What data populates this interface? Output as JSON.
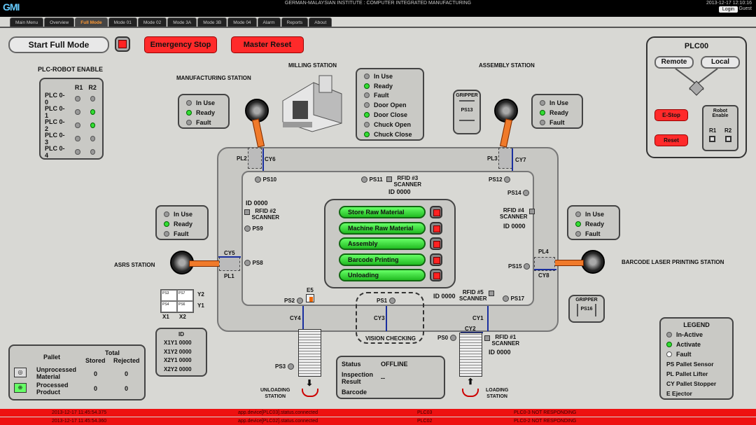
{
  "header": {
    "logo": "GMI",
    "institute": "GERMAN-MALAYSIAN INSTITUTE : COMPUTER INTEGRATED MANUFACTURING",
    "datetime": "2013-12-17 12:10:16",
    "login": "Login",
    "user": "Guest"
  },
  "tabs": [
    "Main Menu",
    "Overview",
    "Full Mode",
    "Mode 01",
    "Mode 02",
    "Mode 3A",
    "Mode 3B",
    "Mode 04",
    "Alarm",
    "Reports",
    "About"
  ],
  "controls": {
    "start": "Start Full Mode",
    "estop": "Emergency Stop",
    "reset": "Master Reset"
  },
  "robot_enable": {
    "title": "PLC-ROBOT ENABLE",
    "cols": [
      "R1",
      "R2"
    ],
    "rows": [
      {
        "name": "PLC 0-0",
        "r1": false,
        "r2": false
      },
      {
        "name": "PLC 0-1",
        "r1": false,
        "r2": true
      },
      {
        "name": "PLC 0-2",
        "r1": false,
        "r2": true
      },
      {
        "name": "PLC 0-3",
        "r1": false,
        "r2": false
      },
      {
        "name": "PLC 0-4",
        "r1": false,
        "r2": false
      }
    ]
  },
  "stations": {
    "manufacturing": "MANUFACTURING STATION",
    "milling": "MILLING STATION",
    "assembly": "ASSEMBLY STATION",
    "asrs": "ASRS STATION",
    "barcode": "BARCODE LASER PRINTING STATION",
    "unloading": "UNLOADING\nSTATION",
    "loading": "LOADING\nSTATION",
    "vision": "VISION CHECKING"
  },
  "status3": {
    "in_use": "In Use",
    "ready": "Ready",
    "fault": "Fault"
  },
  "milling_status": [
    "In Use",
    "Ready",
    "Fault",
    "Door Open",
    "Door Close",
    "Chuck Open",
    "Chuck Close"
  ],
  "milling_on": [
    false,
    true,
    false,
    false,
    true,
    false,
    true
  ],
  "gripper": {
    "title": "GRIPPER",
    "ps13": "PS13",
    "ps16": "PS16"
  },
  "track": {
    "pl2": "PL2",
    "cy6": "CY6",
    "pl3": "PL3",
    "cy7": "CY7",
    "ps10": "PS10",
    "ps11": "PS11",
    "rfid3": "RFID #3\nSCANNER",
    "id3": "ID  0000",
    "ps12": "PS12",
    "ps14": "PS14",
    "id2": "ID  0000",
    "rfid2": "RFID #2\nSCANNER",
    "ps9": "PS9",
    "rfid4": "RFID #4\nSCANNER",
    "id4": "ID  0000",
    "cy5": "CY5",
    "pl1": "PL1",
    "ps8": "PS8",
    "pl4": "PL4",
    "cy8": "CY8",
    "ps15": "PS15",
    "ps2": "PS2",
    "e5": "E5",
    "ps1": "PS1",
    "id5": "ID  0000",
    "rfid5": "RFID #5\nSCANNER",
    "ps17": "PS17",
    "cy4": "CY4",
    "cy3": "CY3",
    "cy1": "CY1",
    "cy2": "CY2",
    "ps0": "PS0",
    "rfid1": "RFID #1\nSCANNER",
    "id1": "ID  0000",
    "ps3": "PS3"
  },
  "modes": [
    "Store Raw Material",
    "Machine Raw Material",
    "Assembly",
    "Barcode Printing",
    "Unloading"
  ],
  "grid": {
    "cells": [
      "PS3",
      "PS7",
      "PS4",
      "PS6"
    ],
    "y2": "Y2",
    "y1": "Y1",
    "x1": "X1",
    "x2": "X2"
  },
  "id_panel": {
    "title": "ID",
    "rows": [
      "X1Y1 0000",
      "X1Y2 0000",
      "X2Y1 0000",
      "X2Y2 0000"
    ]
  },
  "pallet": {
    "title": "Pallet",
    "total": "Total",
    "stored": "Stored",
    "rejected": "Rejected",
    "rows": [
      {
        "name": "Unprocessed\nMaterial",
        "stored": "0",
        "rejected": "0"
      },
      {
        "name": "Processed\nProduct",
        "stored": "0",
        "rejected": "0"
      }
    ]
  },
  "vision_panel": {
    "status_lbl": "Status",
    "status_val": "OFFLINE",
    "insp_lbl": "Inspection\nResult",
    "insp_val": "--",
    "barcode_lbl": "Barcode"
  },
  "plc00": {
    "title": "PLC00",
    "remote": "Remote",
    "local": "Local",
    "estop": "E-Stop",
    "reset": "Reset",
    "robot": "Robot\nEnable",
    "r1": "R1",
    "r2": "R2"
  },
  "legend": {
    "title": "LEGEND",
    "items": [
      "In-Active",
      "Activate",
      "Fault"
    ],
    "defs": [
      "PS Pallet Sensor",
      "PL Pallet Lifter",
      "CY Pallet Stopper",
      "E Ejector"
    ]
  },
  "footer": [
    {
      "time": "2013-12-17 11:45:54.375",
      "msg": "app.device[PLC03].status.connected",
      "src": "PLC03",
      "text": "PLC0-3 NOT RESPONDING"
    },
    {
      "time": "2013-12-17 11:45:54.360",
      "msg": "app.device[PLC02].status.connected",
      "src": "PLC02",
      "text": "PLC0-2 NOT RESPONDING"
    }
  ]
}
